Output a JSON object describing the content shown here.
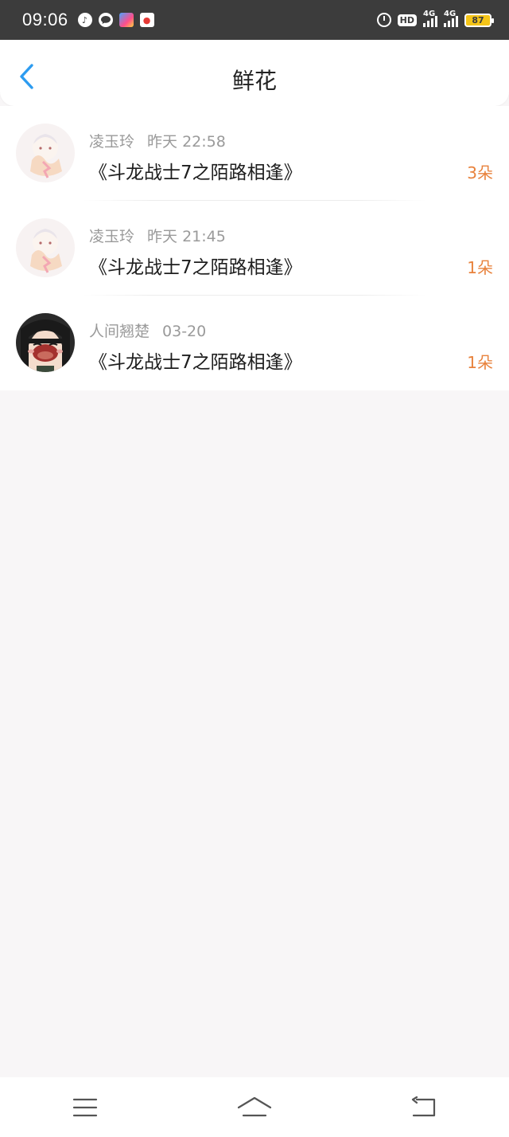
{
  "status_bar": {
    "time": "09:06",
    "hd_label": "HD",
    "network_1": "4G",
    "network_2": "4G",
    "battery": "87"
  },
  "header": {
    "title": "鲜花",
    "back_icon": "chevron-left-icon"
  },
  "colors": {
    "accent_blue": "#2d9cf0",
    "count_orange": "#e8823c"
  },
  "flowers": [
    {
      "user": "凌玉玲",
      "day": "昨天",
      "time": "22:58",
      "book": "《斗龙战士7之陌路相逢》",
      "count": "3朵"
    },
    {
      "user": "凌玉玲",
      "day": "昨天",
      "time": "21:45",
      "book": "《斗龙战士7之陌路相逢》",
      "count": "1朵"
    },
    {
      "user": "人间翘楚",
      "day": "",
      "time": "03-20",
      "book": "《斗龙战士7之陌路相逢》",
      "count": "1朵"
    }
  ],
  "nav": {
    "menu_icon": "menu-icon",
    "home_icon": "home-icon",
    "back_icon": "back-icon"
  }
}
